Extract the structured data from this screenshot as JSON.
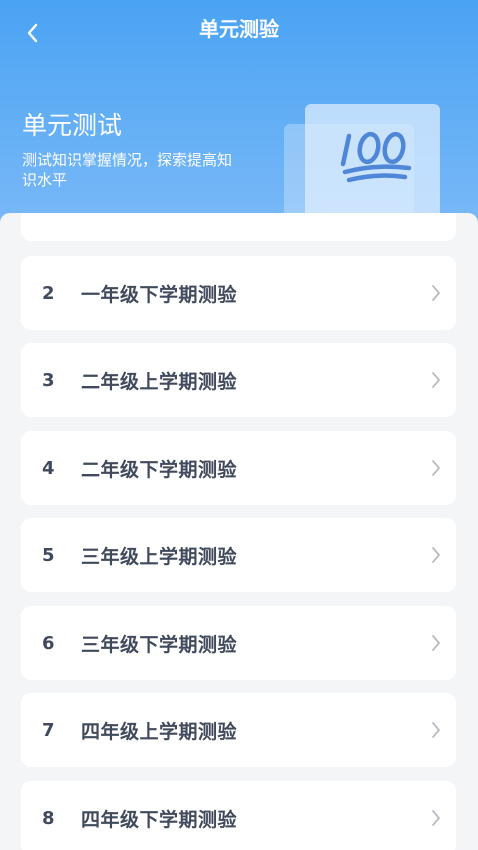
{
  "nav": {
    "title": "单元测验"
  },
  "hero": {
    "title": "单元测试",
    "subtitle": "测试知识掌握情况，探索提高知识水平",
    "badge_icon": "hundred-points-icon"
  },
  "list": {
    "items": [
      {
        "num": "2",
        "label": "一年级下学期测验"
      },
      {
        "num": "3",
        "label": "二年级上学期测验"
      },
      {
        "num": "4",
        "label": "二年级下学期测验"
      },
      {
        "num": "5",
        "label": "三年级上学期测验"
      },
      {
        "num": "6",
        "label": "三年级下学期测验"
      },
      {
        "num": "7",
        "label": "四年级上学期测验"
      },
      {
        "num": "8",
        "label": "四年级下学期测验"
      }
    ]
  },
  "colors": {
    "header_top": "#4aa3f3",
    "header_bottom": "#7ebbf8",
    "text": "#404a5c",
    "background": "#f4f5f7"
  }
}
